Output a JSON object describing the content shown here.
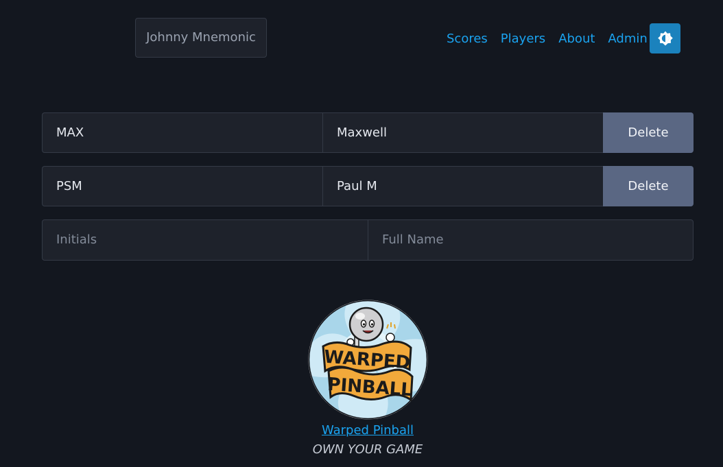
{
  "header": {
    "machine_name": "Johnny Mnemonic",
    "nav": {
      "scores": "Scores",
      "players": "Players",
      "about": "About",
      "admin": "Admin"
    },
    "theme_toggle_icon": "brightness-icon"
  },
  "players": [
    {
      "initials": "MAX",
      "full_name": "Maxwell",
      "delete_label": "Delete"
    },
    {
      "initials": "PSM",
      "full_name": "Paul M",
      "delete_label": "Delete"
    }
  ],
  "new_player": {
    "initials_placeholder": "Initials",
    "full_name_placeholder": "Full Name"
  },
  "footer": {
    "logo_text_top": "WARPED",
    "logo_text_bottom": "PINBALL",
    "link": "Warped Pinball",
    "tagline": "OWN YOUR GAME"
  },
  "colors": {
    "background": "#13171f",
    "accent": "#1aa3f0",
    "delete_button": "#5a6783",
    "toggle_button": "#1b82bd"
  }
}
